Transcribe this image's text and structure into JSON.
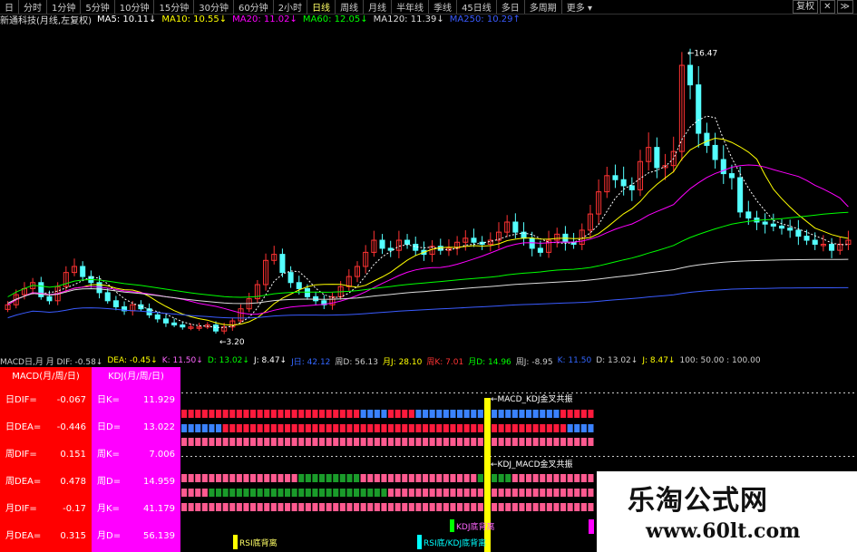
{
  "toolbar": {
    "items": [
      "日",
      "分时",
      "1分钟",
      "5分钟",
      "10分钟",
      "15分钟",
      "30分钟",
      "60分钟",
      "2小时",
      "日线",
      "周线",
      "月线",
      "半年线",
      "季线",
      "45日线",
      "多日",
      "多周期",
      "更多 ▾"
    ],
    "right": [
      "复权",
      "✕",
      "≫"
    ]
  },
  "ma_line": {
    "title": "新通科技(月线,左复权)",
    "items": [
      {
        "text": "MA5: 10.11↓",
        "color": "#ffffff"
      },
      {
        "text": "MA10: 10.55↓",
        "color": "#ffff00"
      },
      {
        "text": "MA20: 11.02↓",
        "color": "#ff00ff"
      },
      {
        "text": "MA60: 12.05↓",
        "color": "#00ff00"
      },
      {
        "text": "MA120: 11.39↓",
        "color": "#dddddd"
      },
      {
        "text": "MA250: 10.29↑",
        "color": "#3a5bff"
      }
    ]
  },
  "chart_annotations": {
    "high": "16.47",
    "low": "3.20"
  },
  "indicator_line": {
    "items": [
      {
        "text": "MACD日,月 月 DIF: -0.58↓",
        "color": "#cccccc"
      },
      {
        "text": "DEA: -0.45↓",
        "color": "#ffff00"
      },
      {
        "text": "K: 11.50↓",
        "color": "#ff66ff"
      },
      {
        "text": "D: 13.02↓",
        "color": "#00ff00"
      },
      {
        "text": "J: 8.47↓",
        "color": "#ffffff"
      },
      {
        "text": "J日: 42.12",
        "color": "#3366ff"
      },
      {
        "text": "周D: 56.13",
        "color": "#cccccc"
      },
      {
        "text": "月J: 28.10",
        "color": "#ffff00"
      },
      {
        "text": "周K: 7.01",
        "color": "#ff3333"
      },
      {
        "text": "月D: 14.96",
        "color": "#00ff00"
      },
      {
        "text": "周J: -8.95",
        "color": "#cccccc"
      },
      {
        "text": "K: 11.50",
        "color": "#3366ff"
      },
      {
        "text": "D: 13.02↓",
        "color": "#cccccc"
      },
      {
        "text": "J: 8.47↓",
        "color": "#ffff00"
      },
      {
        "text": "100: 50.00 : 100.00",
        "color": "#cccccc"
      }
    ]
  },
  "macd_panel": {
    "title": "MACD(月/周/日)",
    "rows": [
      {
        "label": "日DIF=",
        "value": "-0.067"
      },
      {
        "label": "日DEA=",
        "value": "-0.446"
      },
      {
        "label": "周DIF=",
        "value": "0.151"
      },
      {
        "label": "周DEA=",
        "value": "0.478"
      },
      {
        "label": "月DIF=",
        "value": "-0.17"
      },
      {
        "label": "月DEA=",
        "value": "0.315"
      }
    ]
  },
  "kdj_panel": {
    "title": "KDJ(月/周/日)",
    "rows": [
      {
        "label": "日K=",
        "value": "11.929"
      },
      {
        "label": "日D=",
        "value": "13.022"
      },
      {
        "label": "周K=",
        "value": "7.006"
      },
      {
        "label": "周D=",
        "value": "14.959"
      },
      {
        "label": "月K=",
        "value": "41.179"
      },
      {
        "label": "月D=",
        "value": "56.139"
      }
    ]
  },
  "signals": {
    "macd_kdj": "MACD_KDJ金叉共振",
    "kdj_macd": "KDJ_MACD金叉共振",
    "bottom_labels": [
      "RSI底背离",
      "KDJ底背离",
      "RSI底/KDJ底背离"
    ]
  },
  "watermark": {
    "line1": "乐淘公式网",
    "line2": "www.60lt.com"
  },
  "colors": {
    "up": "#ff3333",
    "down": "#54ffff",
    "macd_bg": "#ff0000",
    "kdj_bg": "#ff00ff",
    "strip_red": "#ff1a3c",
    "strip_blue": "#3a82ff",
    "strip_green": "#1a9b2a",
    "strip_pink": "#ff5a90"
  },
  "chart_data": {
    "type": "candlestick",
    "close_series": [
      4.6,
      5.1,
      5.4,
      5.7,
      5.0,
      4.8,
      5.5,
      6.2,
      6.5,
      6.0,
      5.7,
      5.2,
      4.8,
      4.5,
      4.3,
      4.6,
      4.4,
      4.1,
      3.9,
      3.7,
      3.6,
      3.5,
      3.5,
      3.5,
      3.6,
      3.3,
      3.5,
      3.8,
      4.4,
      4.9,
      5.6,
      6.8,
      7.1,
      6.2,
      5.7,
      5.4,
      5.0,
      4.8,
      4.6,
      5.0,
      5.5,
      6.0,
      6.5,
      7.2,
      7.8,
      7.4,
      7.3,
      7.8,
      7.6,
      7.3,
      7.1,
      7.5,
      7.3,
      7.4,
      7.7,
      7.9,
      7.7,
      7.6,
      7.8,
      8.2,
      8.7,
      8.2,
      7.9,
      7.4,
      7.2,
      7.8,
      8.1,
      7.7,
      7.6,
      8.3,
      9.1,
      10.2,
      11.0,
      10.8,
      10.5,
      10.3,
      11.7,
      12.4,
      11.4,
      11.5,
      12.2,
      16.47,
      15.5,
      13.1,
      12.5,
      11.8,
      11.1,
      10.9,
      9.2,
      8.9,
      8.7,
      8.6,
      8.5,
      8.4,
      8.3,
      8.0,
      7.8,
      7.6,
      7.6,
      7.3,
      7.6,
      7.8
    ]
  }
}
